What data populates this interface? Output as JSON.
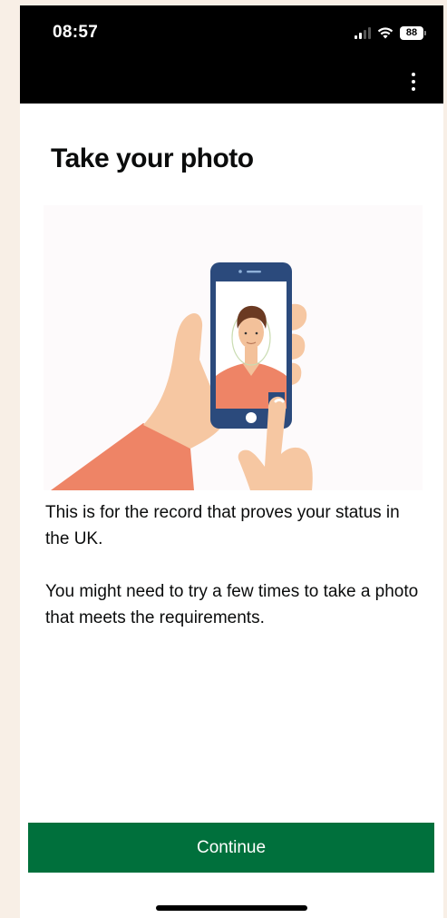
{
  "status_bar": {
    "time": "08:57",
    "battery": "88",
    "icons": [
      "signal-icon",
      "wifi-icon",
      "battery-icon"
    ]
  },
  "header": {
    "menu_icon": "more-vertical-icon"
  },
  "page": {
    "title": "Take your photo",
    "paragraphs": [
      "This is for the record that proves your status in the UK.",
      "You might need to try a few times to take a photo that meets the requirements."
    ]
  },
  "illustration": {
    "subject": "hand-holding-phone-taking-selfie"
  },
  "actions": {
    "continue_label": "Continue"
  },
  "colors": {
    "primary_button": "#00703c",
    "status_bar_bg": "#000000",
    "text": "#0b0c0c",
    "page_margin_bg": "#f8efe6"
  }
}
